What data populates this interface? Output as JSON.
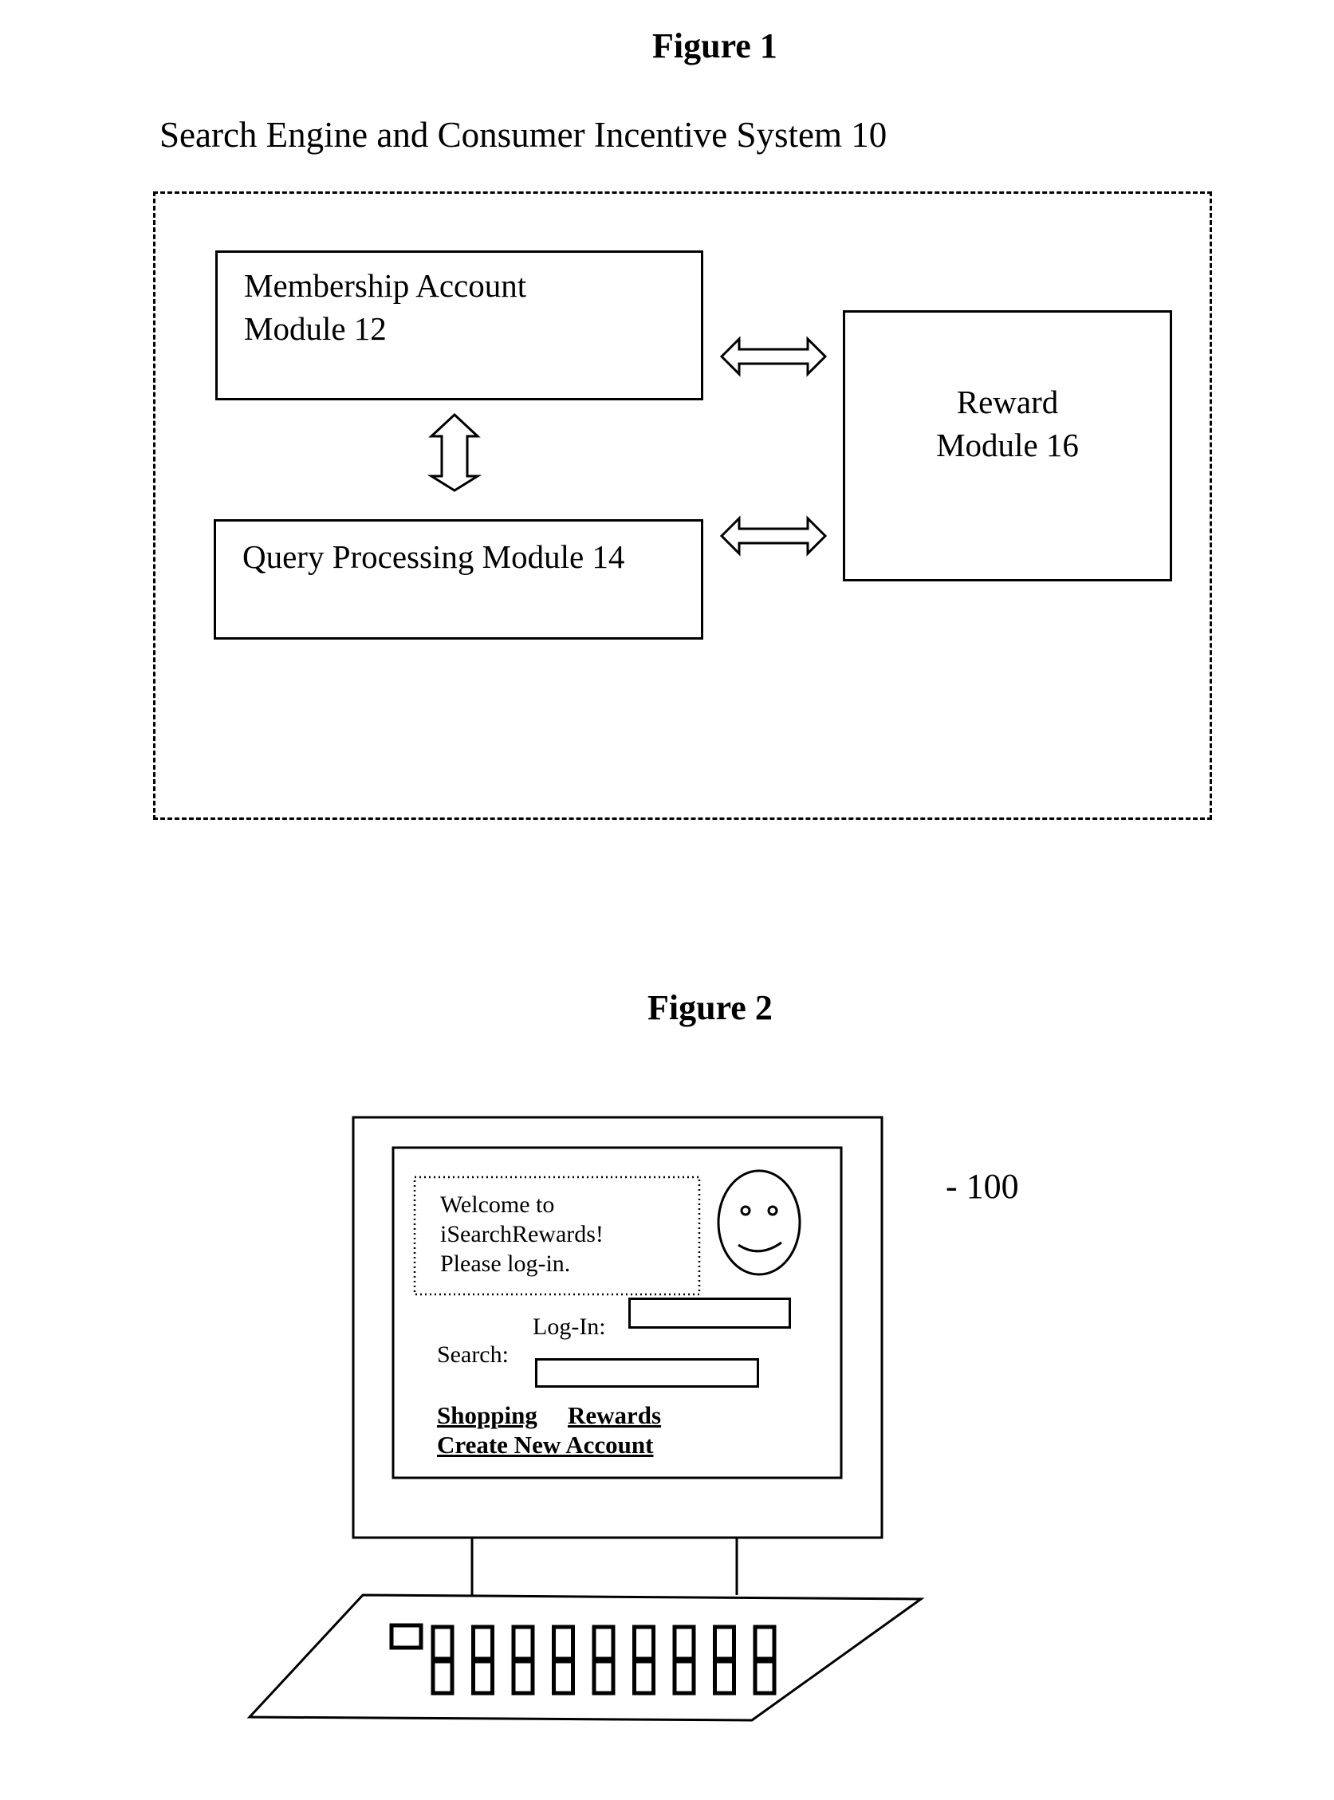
{
  "figure1": {
    "label": "Figure 1",
    "system_title": "Search Engine and Consumer Incentive System 10",
    "modules": {
      "membership": {
        "line1": "Membership Account",
        "line2": "Module 12"
      },
      "query": {
        "line1": "Query Processing Module 14"
      },
      "reward": {
        "line1": "Reward",
        "line2": "Module 16"
      }
    },
    "connections": [
      {
        "from": "Membership Account Module 12",
        "to": "Reward Module 16",
        "type": "bidirectional"
      },
      {
        "from": "Membership Account Module 12",
        "to": "Query Processing Module 14",
        "type": "bidirectional"
      },
      {
        "from": "Query Processing Module 14",
        "to": "Reward Module 16",
        "type": "bidirectional"
      }
    ]
  },
  "figure2": {
    "label": "Figure 2",
    "reference": "- 100",
    "screen": {
      "welcome_lines": [
        "Welcome to",
        "iSearchRewards!",
        "Please log-in."
      ],
      "login_label": "Log-In:",
      "login_value": "",
      "search_label": "Search:",
      "search_value": "",
      "links": {
        "shopping": "Shopping",
        "rewards": "Rewards",
        "create_account": "Create New Account"
      }
    },
    "keyboard_key_count": 9
  }
}
